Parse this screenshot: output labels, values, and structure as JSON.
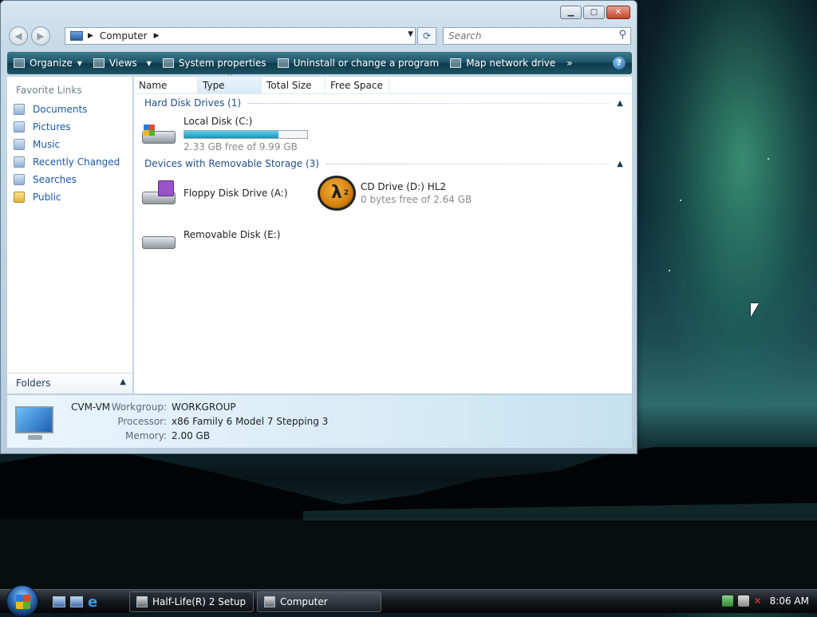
{
  "window": {
    "address": "Computer",
    "search_placeholder": "Search"
  },
  "toolbar": {
    "items": [
      "Organize",
      "Views",
      "System properties",
      "Uninstall or change a program",
      "Map network drive"
    ],
    "more": "»",
    "help": "?"
  },
  "sidebar": {
    "heading": "Favorite Links",
    "links": [
      "Documents",
      "Pictures",
      "Music",
      "Recently Changed",
      "Searches",
      "Public"
    ],
    "folders_label": "Folders"
  },
  "columns": [
    "Name",
    "Type",
    "Total Size",
    "Free Space"
  ],
  "groups": {
    "hdd": {
      "title": "Hard Disk Drives (1)",
      "drives": [
        {
          "name": "Local Disk (C:)",
          "free_text": "2.33 GB free of 9.99 GB",
          "used_fraction": 0.767
        }
      ]
    },
    "removable": {
      "title": "Devices with Removable Storage (3)",
      "drives": [
        {
          "name": "Floppy Disk Drive (A:)"
        },
        {
          "name": "CD Drive (D:) HL2",
          "free_text": "0 bytes free of 2.64 GB"
        },
        {
          "name": "Removable Disk (E:)"
        }
      ]
    }
  },
  "details": {
    "computer_name": "CVM-VM",
    "rows": [
      {
        "key": "Workgroup:",
        "value": "WORKGROUP"
      },
      {
        "key": "Processor:",
        "value": "x86 Family 6 Model 7 Stepping 3"
      },
      {
        "key": "Memory:",
        "value": "2.00 GB"
      }
    ]
  },
  "taskbar": {
    "tasks": [
      "Half-Life(R) 2 Setup",
      "Computer"
    ],
    "clock": "8:06 AM"
  }
}
